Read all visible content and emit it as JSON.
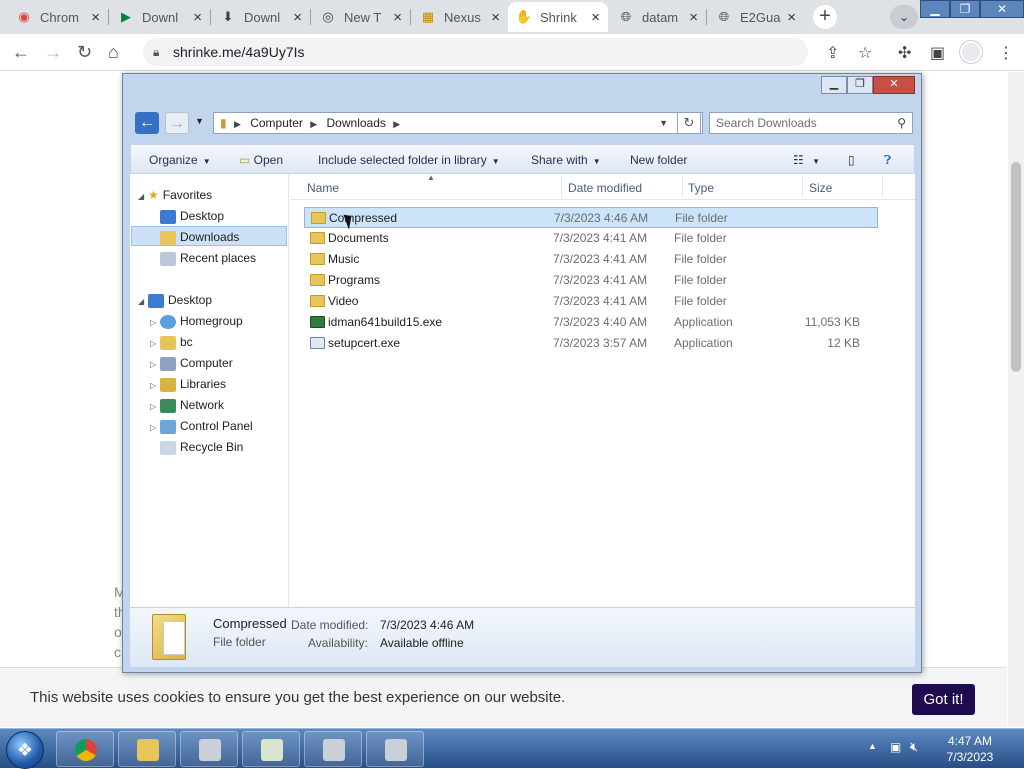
{
  "browser": {
    "tabs": [
      {
        "title": "Chrom",
        "icon": "chrome-icon"
      },
      {
        "title": "Downl",
        "icon": "play-icon"
      },
      {
        "title": "Downl",
        "icon": "download-icon"
      },
      {
        "title": "New T",
        "icon": "chrome-icon"
      },
      {
        "title": "Nexus",
        "icon": "nexus-icon"
      },
      {
        "title": "Shrink",
        "icon": "hand-icon"
      },
      {
        "title": "datam",
        "icon": "globe-icon"
      },
      {
        "title": "E2Gua",
        "icon": "globe-icon"
      }
    ],
    "url": "shrinke.me/4a9Uy7Is"
  },
  "page": {
    "cookie_message": "This website uses cookies to ensure you get the best experience on our website.",
    "cookie_button": "Got it!",
    "partial_text": [
      "M",
      "th",
      "o",
      "c"
    ]
  },
  "explorer": {
    "breadcrumb": [
      "Computer",
      "Downloads"
    ],
    "search_placeholder": "Search Downloads",
    "commands": {
      "organize": "Organize",
      "open": "Open",
      "include": "Include selected folder in library",
      "share": "Share with",
      "newfolder": "New folder"
    },
    "nav": {
      "favorites": "Favorites",
      "desktop_fav": "Desktop",
      "downloads": "Downloads",
      "recent": "Recent places",
      "desktop": "Desktop",
      "homegroup": "Homegroup",
      "bc": "bc",
      "computer": "Computer",
      "libraries": "Libraries",
      "network": "Network",
      "controlpanel": "Control Panel",
      "recycle": "Recycle Bin"
    },
    "columns": {
      "name": "Name",
      "date": "Date modified",
      "type": "Type",
      "size": "Size"
    },
    "files": [
      {
        "name": "Compressed",
        "date": "7/3/2023 4:46 AM",
        "type": "File folder",
        "size": ""
      },
      {
        "name": "Documents",
        "date": "7/3/2023 4:41 AM",
        "type": "File folder",
        "size": ""
      },
      {
        "name": "Music",
        "date": "7/3/2023 4:41 AM",
        "type": "File folder",
        "size": ""
      },
      {
        "name": "Programs",
        "date": "7/3/2023 4:41 AM",
        "type": "File folder",
        "size": ""
      },
      {
        "name": "Video",
        "date": "7/3/2023 4:41 AM",
        "type": "File folder",
        "size": ""
      },
      {
        "name": "idman641build15.exe",
        "date": "7/3/2023 4:40 AM",
        "type": "Application",
        "size": "11,053 KB"
      },
      {
        "name": "setupcert.exe",
        "date": "7/3/2023 3:57 AM",
        "type": "Application",
        "size": "12 KB"
      }
    ],
    "details": {
      "name": "Compressed",
      "type": "File folder",
      "date_label": "Date modified:",
      "date_value": "7/3/2023 4:46 AM",
      "avail_label": "Availability:",
      "avail_value": "Available offline"
    }
  },
  "taskbar": {
    "time": "4:47 AM",
    "date": "7/3/2023"
  }
}
